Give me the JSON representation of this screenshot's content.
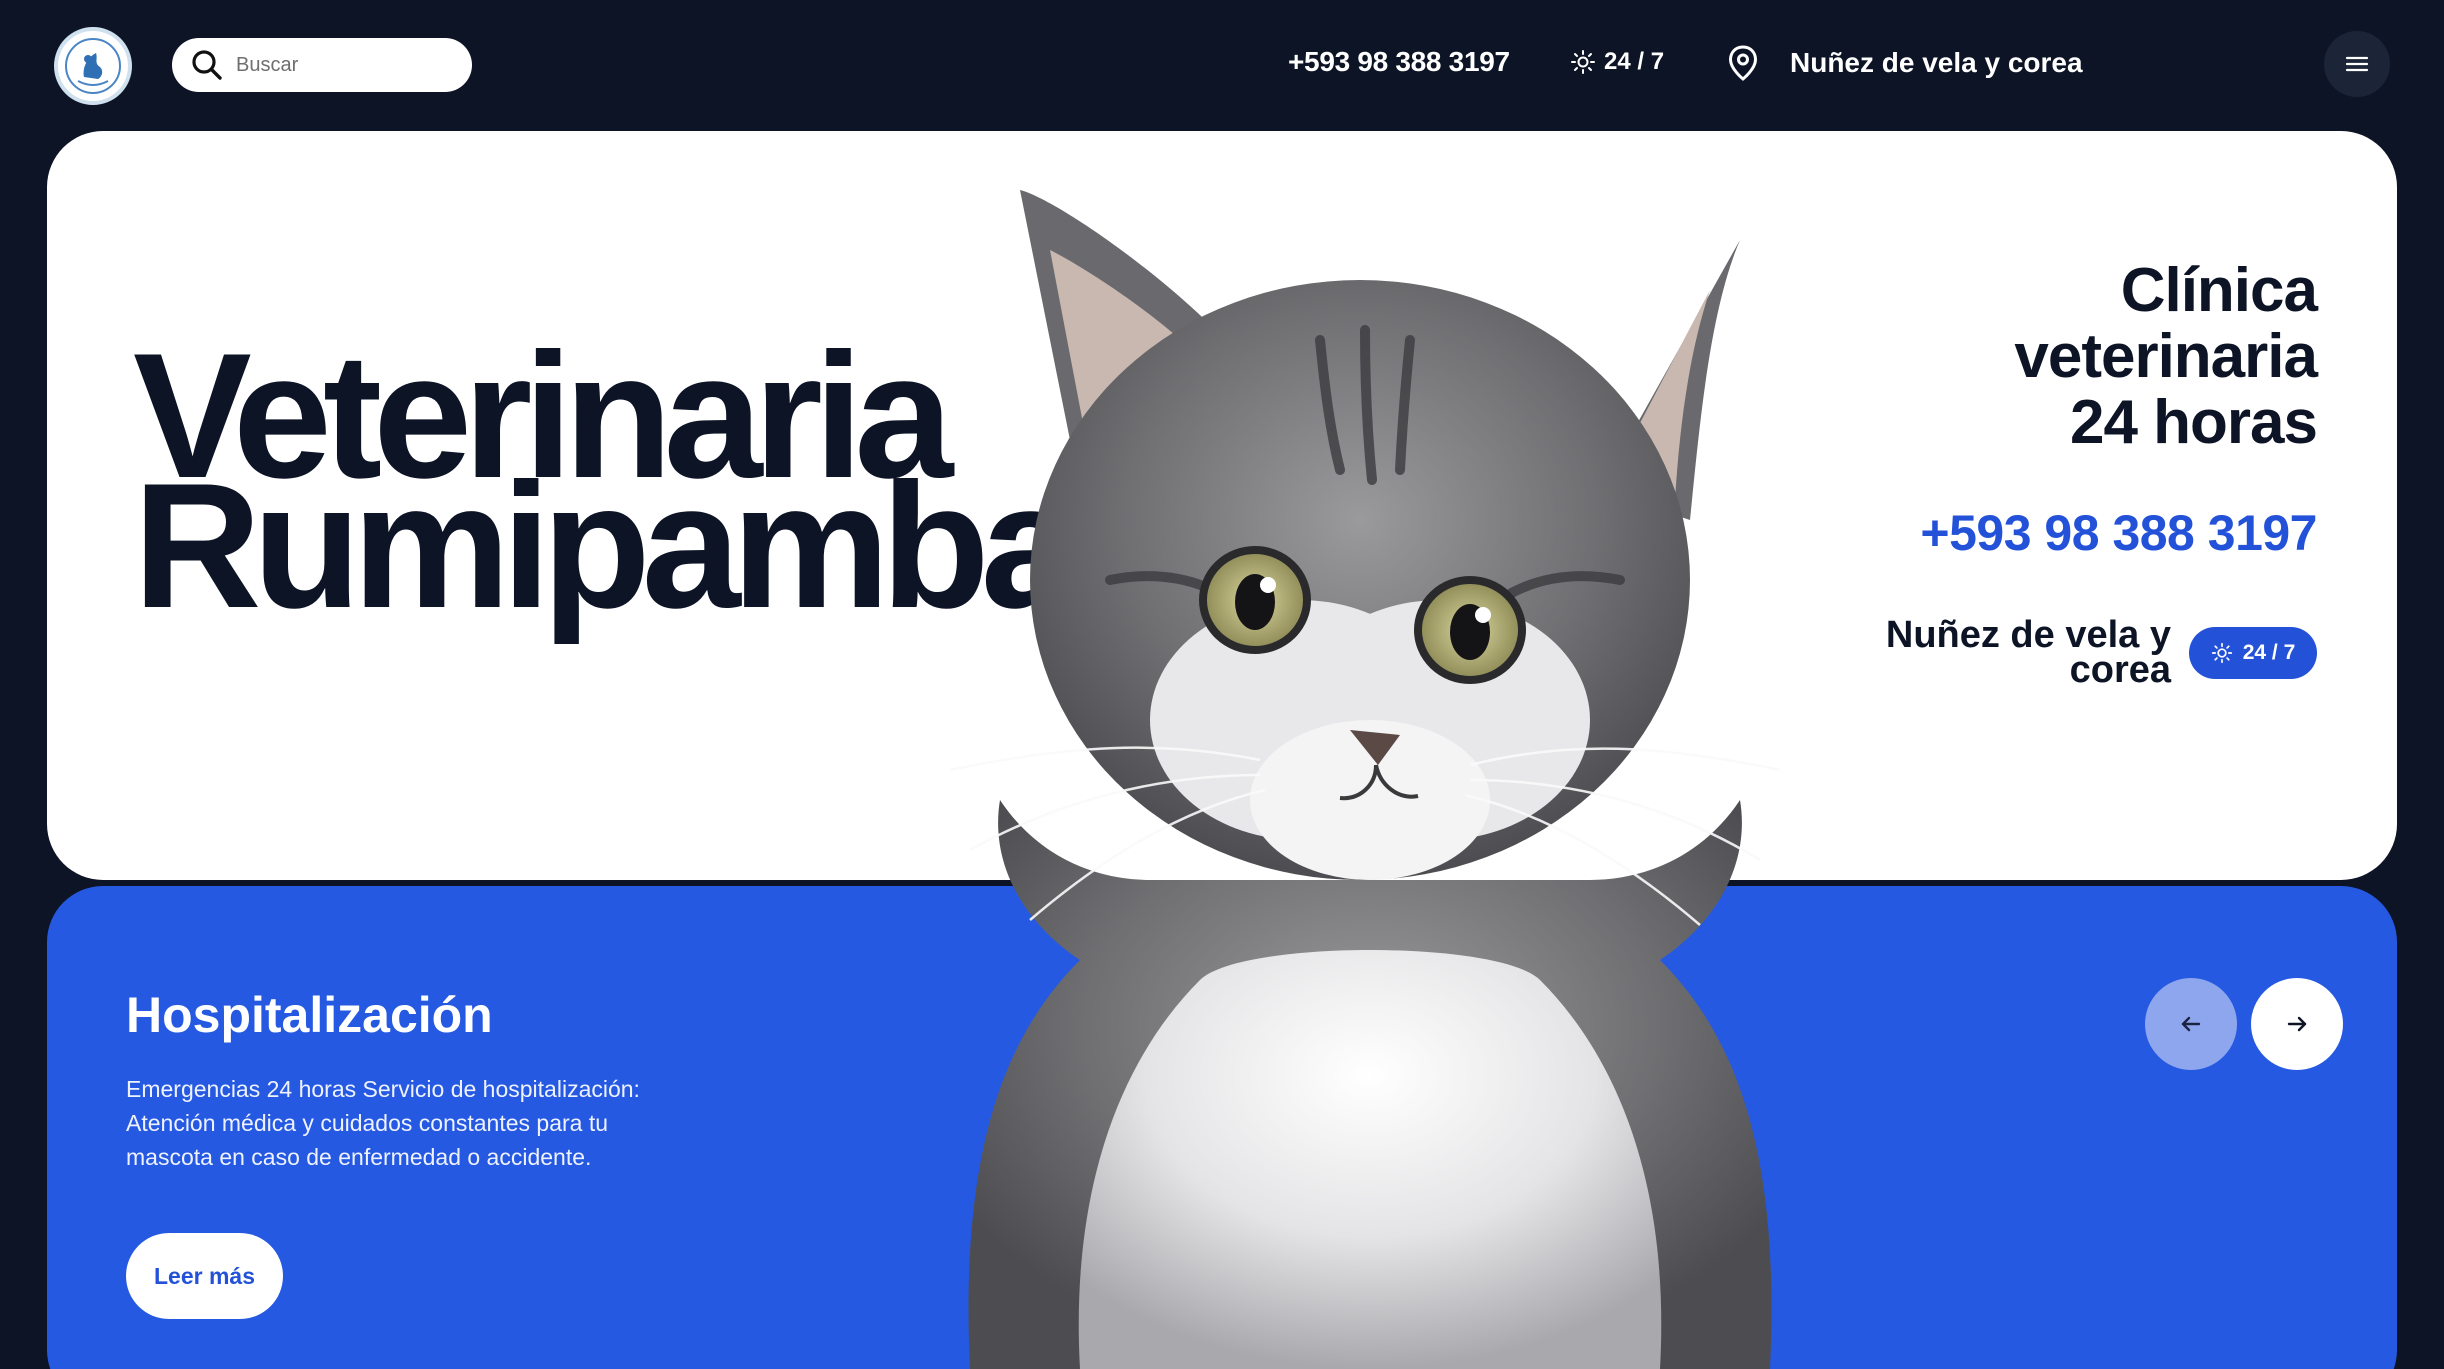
{
  "header": {
    "logo_name": "veterinary-logo",
    "search": {
      "placeholder": "Buscar",
      "value": ""
    },
    "phone": "+593 98 388 3197",
    "hours": "24 / 7",
    "location": "Nuñez de vela y corea",
    "menu_icon": "hamburger-icon"
  },
  "hero": {
    "title_line1": "Veterinaria",
    "title_line2": "Rumipamba",
    "clinic_line1": "Clínica",
    "clinic_line2": "veterinaria",
    "clinic_line3": "24 horas",
    "phone": "+593 98 388 3197",
    "address": "Nuñez de vela y corea",
    "hours_badge": "24 / 7"
  },
  "service": {
    "title": "Hospitalización",
    "description": "Emergencias 24 horas Servicio de hospitalización: Atención médica y cuidados constantes para tu mascota en caso de enfermedad o accidente.",
    "button_label": "Leer más"
  },
  "colors": {
    "background": "#0d1426",
    "accent_blue": "#2352d9",
    "card_blue": "#2559e2",
    "white": "#ffffff"
  }
}
